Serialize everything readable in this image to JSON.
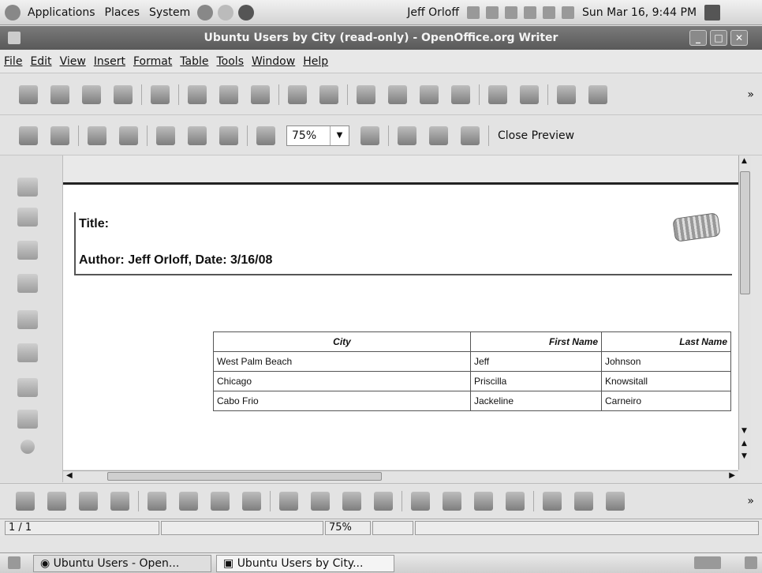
{
  "panel": {
    "applications": "Applications",
    "places": "Places",
    "system": "System",
    "user": "Jeff Orloff",
    "datetime": "Sun Mar 16,  9:44 PM"
  },
  "window": {
    "title": "Ubuntu Users by City (read-only) - OpenOffice.org Writer"
  },
  "menu": [
    "File",
    "Edit",
    "View",
    "Insert",
    "Format",
    "Table",
    "Tools",
    "Window",
    "Help"
  ],
  "preview_toolbar": {
    "zoom": "75%",
    "close_preview": "Close Preview"
  },
  "document": {
    "title_label": "Title:",
    "author_line": "Author: Jeff Orloff, Date: 3/16/08",
    "table": {
      "headers": [
        "City",
        "First Name",
        "Last Name"
      ],
      "rows": [
        [
          "West Palm Beach",
          "Jeff",
          "Johnson"
        ],
        [
          "Chicago",
          "Priscilla",
          "Knowsitall"
        ],
        [
          "Cabo Frio",
          "Jackeline",
          "Carneiro"
        ]
      ]
    }
  },
  "side_tools": [
    "pointer-icon",
    "push-button-icon",
    "form-control-icon",
    "table-control-icon",
    "checkbox-icon",
    "text-box-icon",
    "formatted-field-icon",
    "option-button-icon",
    "radio-icon"
  ],
  "statusbar": {
    "page": "1 / 1",
    "zoom": "75%"
  },
  "taskbar": {
    "task1": "Ubuntu Users - Open...",
    "task2": "Ubuntu Users by City..."
  }
}
